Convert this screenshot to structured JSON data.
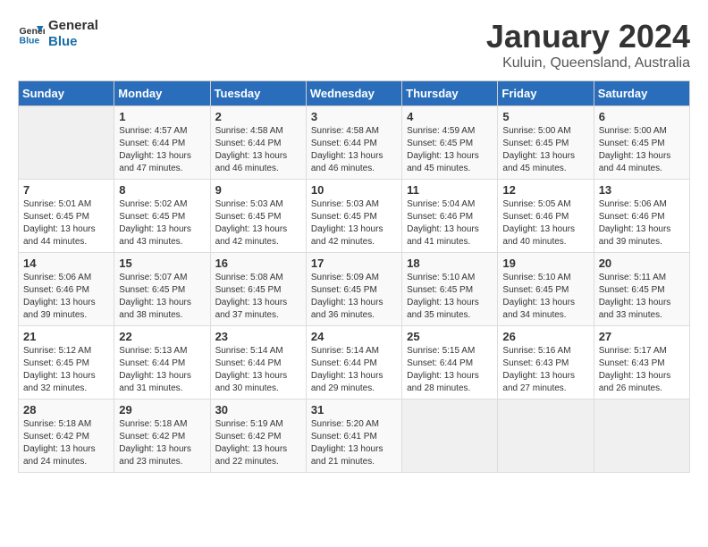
{
  "logo": {
    "line1": "General",
    "line2": "Blue"
  },
  "title": "January 2024",
  "subtitle": "Kuluin, Queensland, Australia",
  "days_of_week": [
    "Sunday",
    "Monday",
    "Tuesday",
    "Wednesday",
    "Thursday",
    "Friday",
    "Saturday"
  ],
  "weeks": [
    [
      {
        "day": "",
        "sunrise": "",
        "sunset": "",
        "daylight": ""
      },
      {
        "day": "1",
        "sunrise": "4:57 AM",
        "sunset": "6:44 PM",
        "daylight": "13 hours and 47 minutes."
      },
      {
        "day": "2",
        "sunrise": "4:58 AM",
        "sunset": "6:44 PM",
        "daylight": "13 hours and 46 minutes."
      },
      {
        "day": "3",
        "sunrise": "4:58 AM",
        "sunset": "6:44 PM",
        "daylight": "13 hours and 46 minutes."
      },
      {
        "day": "4",
        "sunrise": "4:59 AM",
        "sunset": "6:45 PM",
        "daylight": "13 hours and 45 minutes."
      },
      {
        "day": "5",
        "sunrise": "5:00 AM",
        "sunset": "6:45 PM",
        "daylight": "13 hours and 45 minutes."
      },
      {
        "day": "6",
        "sunrise": "5:00 AM",
        "sunset": "6:45 PM",
        "daylight": "13 hours and 44 minutes."
      }
    ],
    [
      {
        "day": "7",
        "sunrise": "5:01 AM",
        "sunset": "6:45 PM",
        "daylight": "13 hours and 44 minutes."
      },
      {
        "day": "8",
        "sunrise": "5:02 AM",
        "sunset": "6:45 PM",
        "daylight": "13 hours and 43 minutes."
      },
      {
        "day": "9",
        "sunrise": "5:03 AM",
        "sunset": "6:45 PM",
        "daylight": "13 hours and 42 minutes."
      },
      {
        "day": "10",
        "sunrise": "5:03 AM",
        "sunset": "6:45 PM",
        "daylight": "13 hours and 42 minutes."
      },
      {
        "day": "11",
        "sunrise": "5:04 AM",
        "sunset": "6:46 PM",
        "daylight": "13 hours and 41 minutes."
      },
      {
        "day": "12",
        "sunrise": "5:05 AM",
        "sunset": "6:46 PM",
        "daylight": "13 hours and 40 minutes."
      },
      {
        "day": "13",
        "sunrise": "5:06 AM",
        "sunset": "6:46 PM",
        "daylight": "13 hours and 39 minutes."
      }
    ],
    [
      {
        "day": "14",
        "sunrise": "5:06 AM",
        "sunset": "6:46 PM",
        "daylight": "13 hours and 39 minutes."
      },
      {
        "day": "15",
        "sunrise": "5:07 AM",
        "sunset": "6:45 PM",
        "daylight": "13 hours and 38 minutes."
      },
      {
        "day": "16",
        "sunrise": "5:08 AM",
        "sunset": "6:45 PM",
        "daylight": "13 hours and 37 minutes."
      },
      {
        "day": "17",
        "sunrise": "5:09 AM",
        "sunset": "6:45 PM",
        "daylight": "13 hours and 36 minutes."
      },
      {
        "day": "18",
        "sunrise": "5:10 AM",
        "sunset": "6:45 PM",
        "daylight": "13 hours and 35 minutes."
      },
      {
        "day": "19",
        "sunrise": "5:10 AM",
        "sunset": "6:45 PM",
        "daylight": "13 hours and 34 minutes."
      },
      {
        "day": "20",
        "sunrise": "5:11 AM",
        "sunset": "6:45 PM",
        "daylight": "13 hours and 33 minutes."
      }
    ],
    [
      {
        "day": "21",
        "sunrise": "5:12 AM",
        "sunset": "6:45 PM",
        "daylight": "13 hours and 32 minutes."
      },
      {
        "day": "22",
        "sunrise": "5:13 AM",
        "sunset": "6:44 PM",
        "daylight": "13 hours and 31 minutes."
      },
      {
        "day": "23",
        "sunrise": "5:14 AM",
        "sunset": "6:44 PM",
        "daylight": "13 hours and 30 minutes."
      },
      {
        "day": "24",
        "sunrise": "5:14 AM",
        "sunset": "6:44 PM",
        "daylight": "13 hours and 29 minutes."
      },
      {
        "day": "25",
        "sunrise": "5:15 AM",
        "sunset": "6:44 PM",
        "daylight": "13 hours and 28 minutes."
      },
      {
        "day": "26",
        "sunrise": "5:16 AM",
        "sunset": "6:43 PM",
        "daylight": "13 hours and 27 minutes."
      },
      {
        "day": "27",
        "sunrise": "5:17 AM",
        "sunset": "6:43 PM",
        "daylight": "13 hours and 26 minutes."
      }
    ],
    [
      {
        "day": "28",
        "sunrise": "5:18 AM",
        "sunset": "6:42 PM",
        "daylight": "13 hours and 24 minutes."
      },
      {
        "day": "29",
        "sunrise": "5:18 AM",
        "sunset": "6:42 PM",
        "daylight": "13 hours and 23 minutes."
      },
      {
        "day": "30",
        "sunrise": "5:19 AM",
        "sunset": "6:42 PM",
        "daylight": "13 hours and 22 minutes."
      },
      {
        "day": "31",
        "sunrise": "5:20 AM",
        "sunset": "6:41 PM",
        "daylight": "13 hours and 21 minutes."
      },
      {
        "day": "",
        "sunrise": "",
        "sunset": "",
        "daylight": ""
      },
      {
        "day": "",
        "sunrise": "",
        "sunset": "",
        "daylight": ""
      },
      {
        "day": "",
        "sunrise": "",
        "sunset": "",
        "daylight": ""
      }
    ]
  ]
}
